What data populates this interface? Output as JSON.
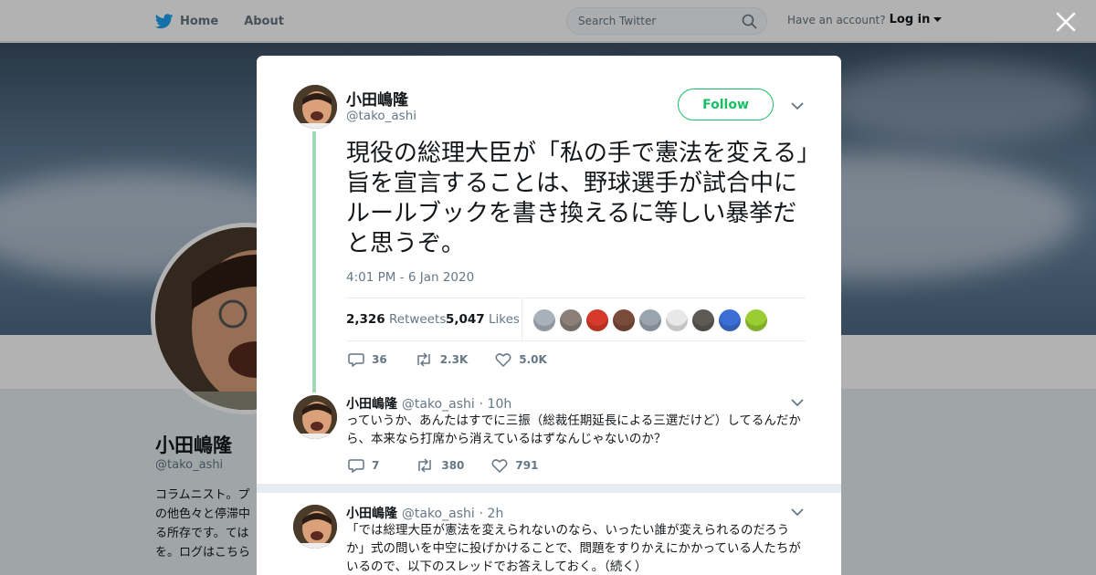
{
  "nav": {
    "home_label": "Home",
    "about_label": "About",
    "search_placeholder": "Search Twitter",
    "account_prompt": "Have an account?",
    "login_label": "Log in"
  },
  "profile": {
    "name": "小田嶋隆",
    "handle": "@tako_ashi",
    "bio": "コラムニスト。プ の他色々と停滞中 る所存です。ては を。ログはこちら"
  },
  "main_tweet": {
    "author_name": "小田嶋隆",
    "author_handle": "@tako_ashi",
    "follow_label": "Follow",
    "text": "現役の総理大臣が「私の手で憲法を変える」旨を宣言することは、野球選手が試合中にルールブックを書き換えるに等しい暴挙だと思うぞ。",
    "timestamp": "4:01 PM - 6 Jan 2020",
    "retweets_count": "2,326",
    "retweets_label": "Retweets",
    "likes_count": "5,047",
    "likes_label": "Likes",
    "liker_colors": [
      "#a8b1ba",
      "#8a8077",
      "#d63a2a",
      "#7a4a3a",
      "#9aa4ae",
      "#e8e8e8",
      "#5c5a52",
      "#3b6fd6",
      "#9acd32"
    ],
    "replies": "36",
    "retweets_short": "2.3K",
    "likes_short": "5.0K"
  },
  "replies": [
    {
      "author_name": "小田嶋隆",
      "author_handle": "@tako_ashi",
      "time": "· 10h",
      "text": "っていうか、あんたはすでに三振（総裁任期延長による三選だけど）してるんだから、本来なら打席から消えているはずなんじゃないのか？",
      "replies": "7",
      "retweets": "380",
      "likes": "791"
    },
    {
      "author_name": "小田嶋隆",
      "author_handle": "@tako_ashi",
      "time": "· 2h",
      "text": "「では総理大臣が憲法を変えられないのなら、いったい誰が変えられるのだろうか」式の問いを中空に投げかけることで、問題をすりかえにかかっている人たちがいるので、以下のスレッドでお答えしておく。（続く）"
    }
  ]
}
